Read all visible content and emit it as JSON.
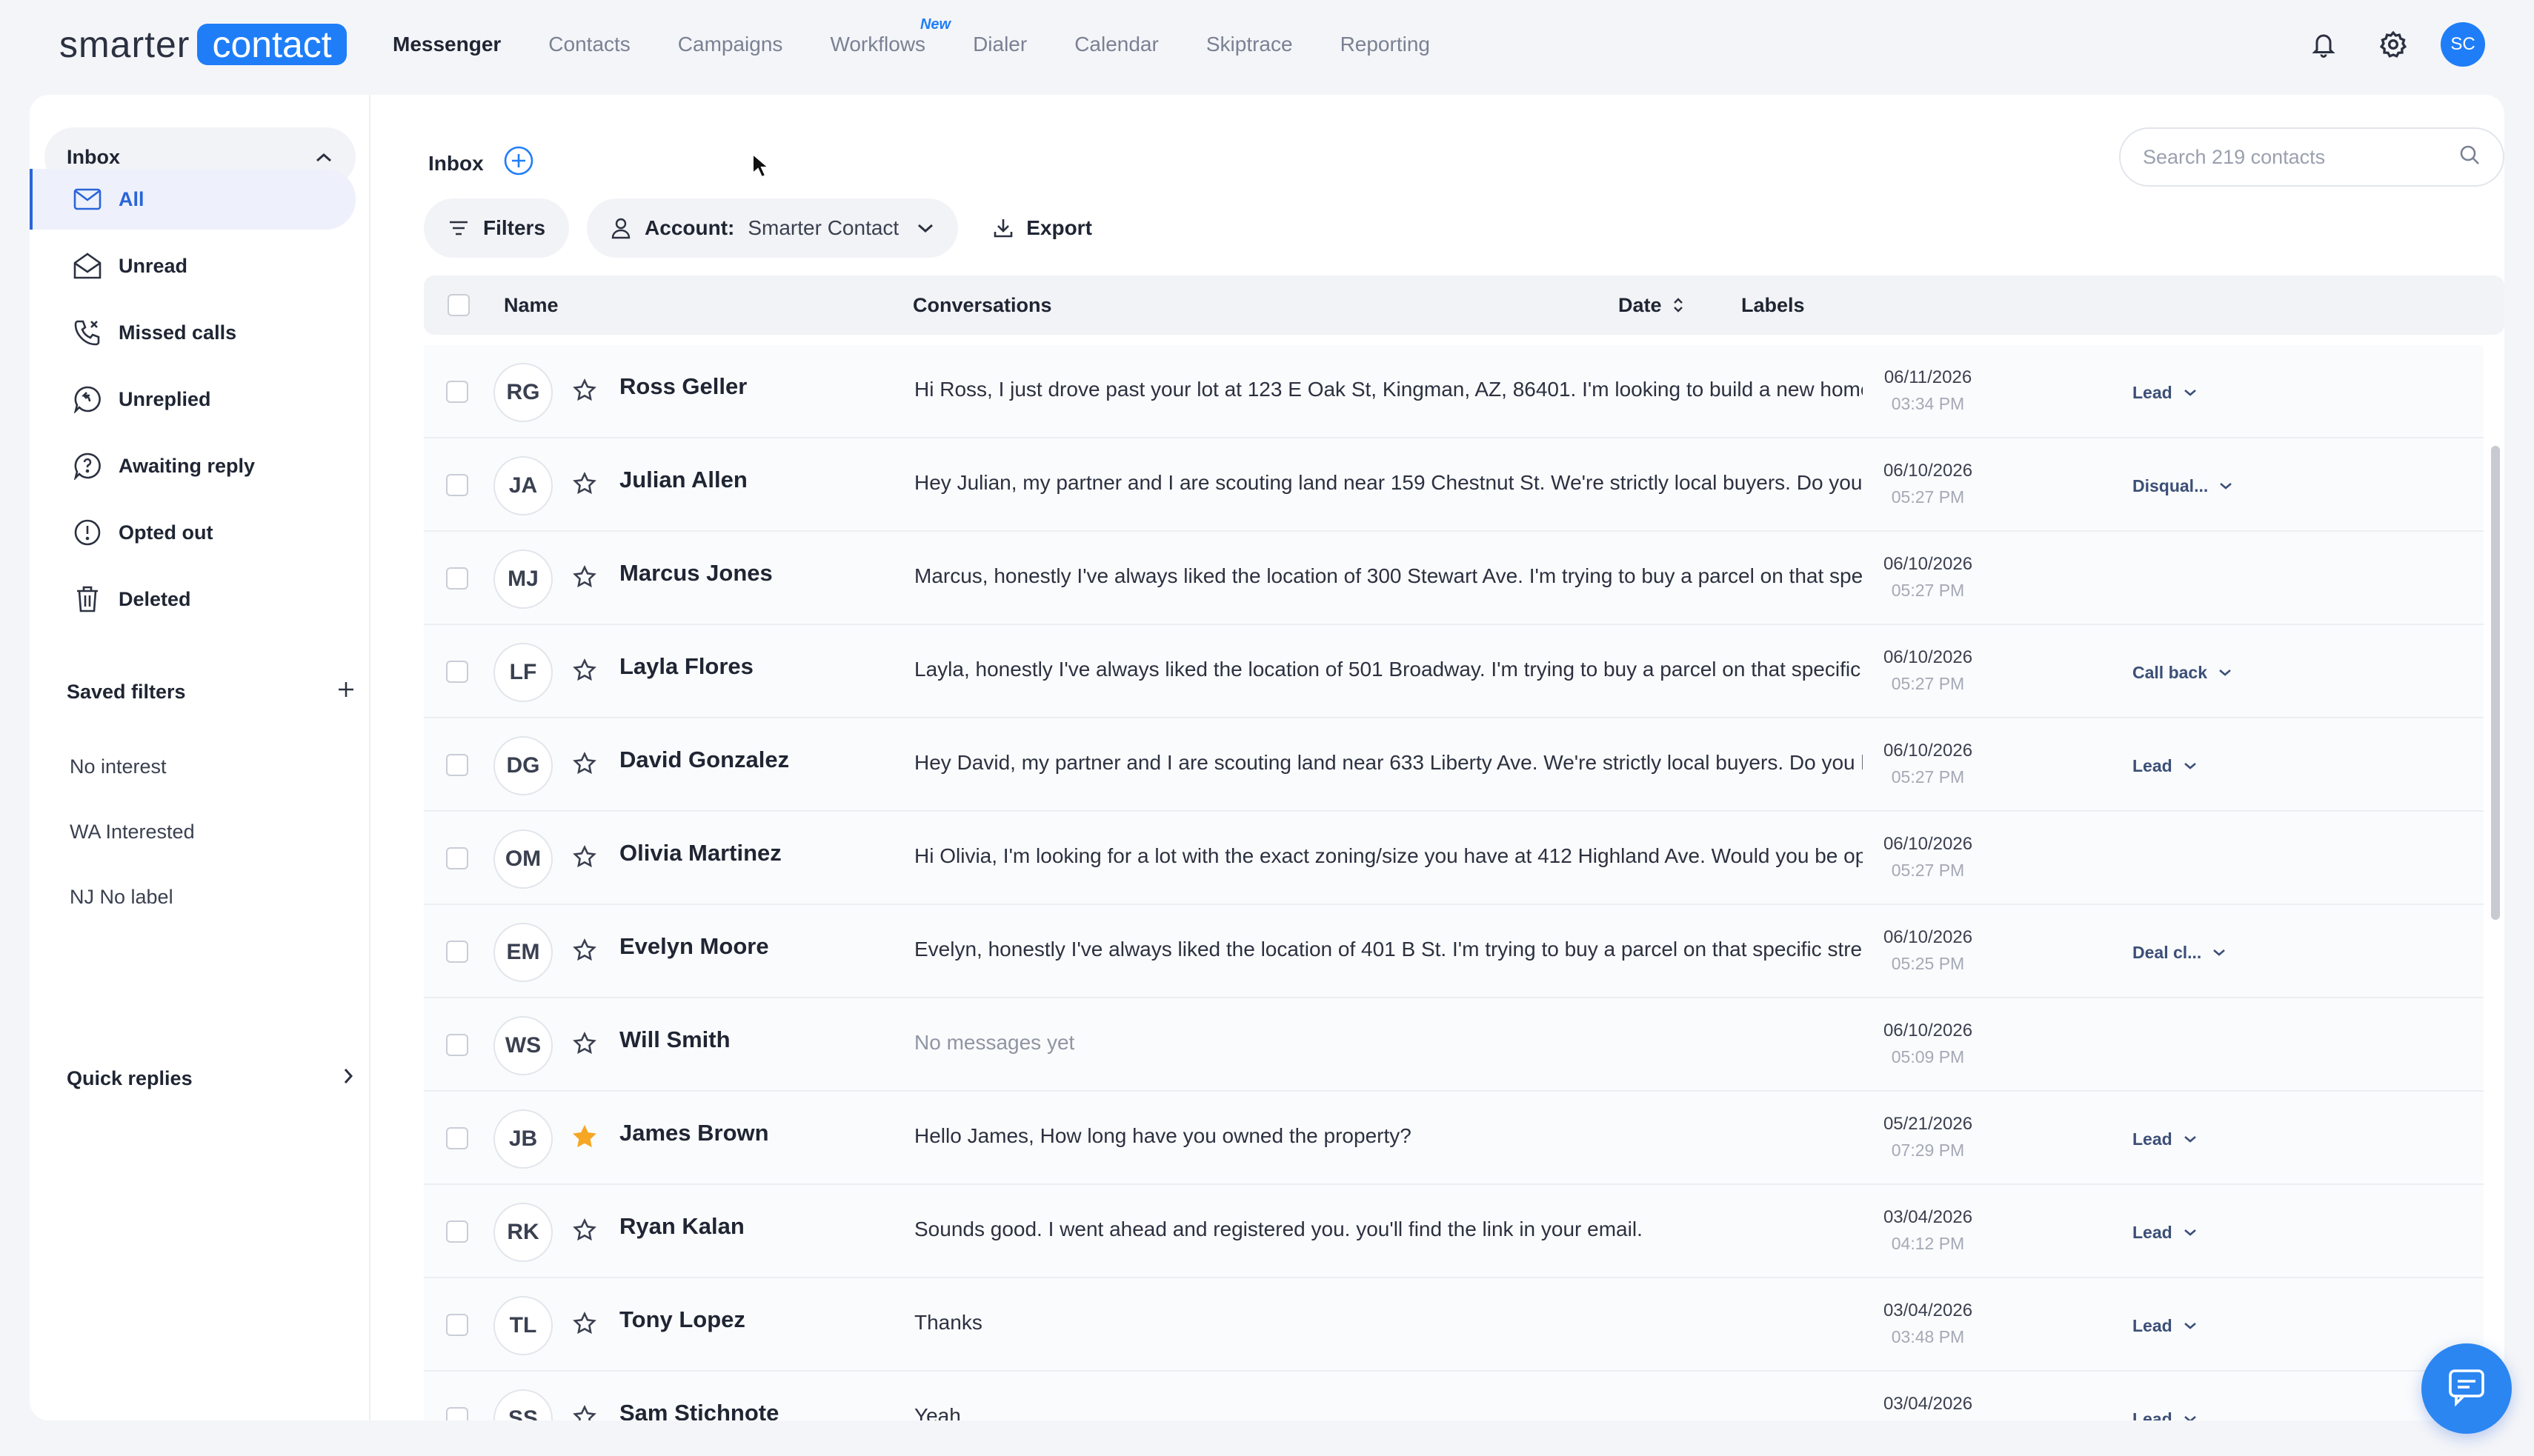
{
  "brand": {
    "part1": "smarter",
    "part2": "contact"
  },
  "nav": [
    {
      "label": "Messenger",
      "active": true
    },
    {
      "label": "Contacts"
    },
    {
      "label": "Campaigns"
    },
    {
      "label": "Workflows",
      "badge": "New"
    },
    {
      "label": "Dialer"
    },
    {
      "label": "Calendar"
    },
    {
      "label": "Skiptrace"
    },
    {
      "label": "Reporting"
    }
  ],
  "user": {
    "initials": "SC"
  },
  "sidebar": {
    "inbox_label": "Inbox",
    "items": [
      {
        "label": "All",
        "icon": "mail-icon",
        "active": true
      },
      {
        "label": "Unread",
        "icon": "envelope-open-icon"
      },
      {
        "label": "Missed calls",
        "icon": "missed-call-icon"
      },
      {
        "label": "Unreplied",
        "icon": "unreplied-icon"
      },
      {
        "label": "Awaiting reply",
        "icon": "question-icon"
      },
      {
        "label": "Opted out",
        "icon": "alert-icon"
      },
      {
        "label": "Deleted",
        "icon": "trash-icon"
      }
    ],
    "saved_filters_label": "Saved filters",
    "saved_filters": [
      "No interest",
      "WA Interested",
      "NJ No label"
    ],
    "quick_replies_label": "Quick replies"
  },
  "main": {
    "title": "Inbox",
    "search_placeholder": "Search 219 contacts",
    "filters_label": "Filters",
    "account_label": "Account:",
    "account_value": "Smarter Contact",
    "export_label": "Export",
    "columns": {
      "name": "Name",
      "conversations": "Conversations",
      "date": "Date",
      "labels": "Labels"
    }
  },
  "rows": [
    {
      "initials": "RG",
      "name": "Ross Geller",
      "starred": false,
      "message": "Hi Ross, I just drove past your lot at 123 E Oak St, Kingman, AZ, 86401. I'm looking to build a new home in t...",
      "date": "06/11/2026",
      "time": "03:34 PM",
      "label": "Lead"
    },
    {
      "initials": "JA",
      "name": "Julian Allen",
      "starred": false,
      "message": "Hey Julian, my partner and I are scouting land near 159 Chestnut St. We're strictly local buyers. Do you hav...",
      "date": "06/10/2026",
      "time": "05:27 PM",
      "label": "Disqual..."
    },
    {
      "initials": "MJ",
      "name": "Marcus Jones",
      "starred": false,
      "message": "Marcus, honestly I've always liked the location of 300 Stewart Ave. I'm trying to buy a parcel on that specific...",
      "date": "06/10/2026",
      "time": "05:27 PM",
      "label": ""
    },
    {
      "initials": "LF",
      "name": "Layla Flores",
      "starred": false,
      "message": "Layla, honestly I've always liked the location of 501 Broadway. I'm trying to buy a parcel on that specific stre...",
      "date": "06/10/2026",
      "time": "05:27 PM",
      "label": "Call back"
    },
    {
      "initials": "DG",
      "name": "David Gonzalez",
      "starred": false,
      "message": "Hey David, my partner and I are scouting land near 633 Liberty Ave. We're strictly local buyers. Do you have ...",
      "date": "06/10/2026",
      "time": "05:27 PM",
      "label": "Lead"
    },
    {
      "initials": "OM",
      "name": "Olivia Martinez",
      "starred": false,
      "message": "Hi Olivia, I'm looking for a lot with the exact zoning/size you have at 412 Highland Ave. Would you be open t...",
      "date": "06/10/2026",
      "time": "05:27 PM",
      "label": ""
    },
    {
      "initials": "EM",
      "name": "Evelyn Moore",
      "starred": false,
      "message": "Evelyn, honestly I've always liked the location of 401 B St. I'm trying to buy a parcel on that specific street. ...",
      "date": "06/10/2026",
      "time": "05:25 PM",
      "label": "Deal cl..."
    },
    {
      "initials": "WS",
      "name": "Will Smith",
      "starred": false,
      "message": "No messages yet",
      "empty": true,
      "date": "06/10/2026",
      "time": "05:09 PM",
      "label": ""
    },
    {
      "initials": "JB",
      "name": "James Brown",
      "starred": true,
      "message": "Hello James, How long have you owned the property?",
      "date": "05/21/2026",
      "time": "07:29 PM",
      "label": "Lead"
    },
    {
      "initials": "RK",
      "name": "Ryan Kalan",
      "starred": false,
      "message": "Sounds good. I went ahead and registered you. you'll find the link in your email.",
      "date": "03/04/2026",
      "time": "04:12 PM",
      "label": "Lead"
    },
    {
      "initials": "TL",
      "name": "Tony Lopez",
      "starred": false,
      "message": "Thanks",
      "date": "03/04/2026",
      "time": "03:48 PM",
      "label": "Lead"
    },
    {
      "initials": "SS",
      "name": "Sam Stichnote",
      "starred": false,
      "message": "Yeah",
      "date": "03/04/2026",
      "time": "",
      "label": "Lead"
    }
  ],
  "colors": {
    "accent": "#1f7ef7",
    "active_nav": "#2a64d8",
    "star": "#f5a623"
  }
}
